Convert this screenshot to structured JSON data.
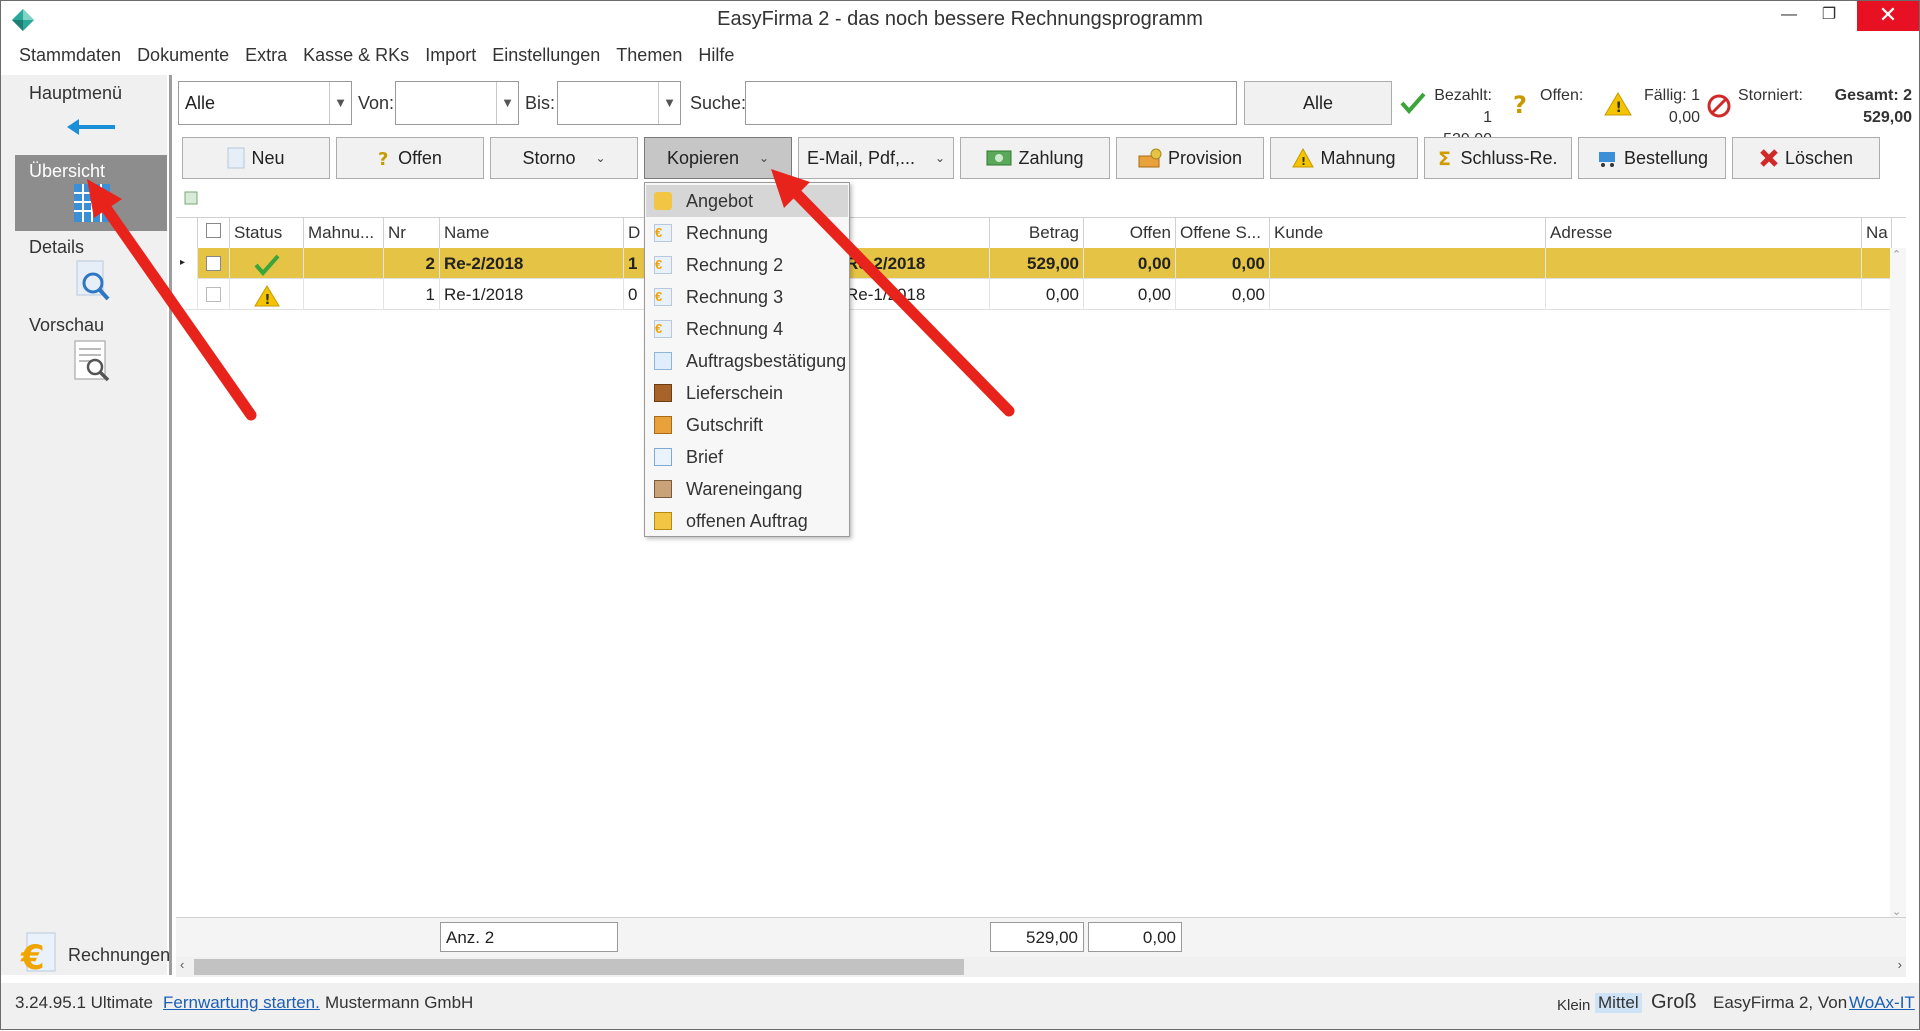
{
  "window": {
    "title": "EasyFirma 2 - das noch bessere Rechnungsprogramm",
    "minimize_glyph": "—",
    "maximize_glyph": "❐",
    "close_glyph": "✕"
  },
  "menu": [
    "Stammdaten",
    "Dokumente",
    "Extra",
    "Kasse & RKs",
    "Import",
    "Einstellungen",
    "Themen",
    "Hilfe"
  ],
  "sidebar": {
    "main_menu": "Hauptmenü",
    "items": [
      "Übersicht",
      "Details",
      "Vorschau"
    ],
    "active": "Übersicht",
    "module_label": "Rechnungen"
  },
  "filters": {
    "type_value": "Alle",
    "from_label": "Von:",
    "from_value": "",
    "to_label": "Bis:",
    "to_value": "",
    "search_label": "Suche:",
    "search_value": "",
    "all_button": "Alle"
  },
  "stats": {
    "paid_label": "Bezahlt: 1",
    "paid_value": "529,00",
    "open_label": "Offen:",
    "due_label": "Fällig: 1",
    "due_value": "0,00",
    "cancelled_label": "Storniert:",
    "total_label": "Gesamt: 2",
    "total_value": "529,00"
  },
  "toolbar": {
    "new": "Neu",
    "open": "Offen",
    "storno": "Storno",
    "copy": "Kopieren",
    "email": "E-Mail, Pdf,...",
    "payment": "Zahlung",
    "commission": "Provision",
    "reminder": "Mahnung",
    "final": "Schluss-Re.",
    "order": "Bestellung",
    "delete": "Löschen"
  },
  "table": {
    "columns": [
      "",
      "Status",
      "Mahnu...",
      "Nr",
      "Name",
      "D",
      "",
      "Betrag",
      "Offen",
      "Offene S...",
      "Kunde",
      "Adresse",
      "Na"
    ],
    "rows": [
      {
        "status": "paid",
        "nr": "2",
        "name": "Re-2/2018",
        "d": "1",
        "ref": "Re-2/2018",
        "betrag": "529,00",
        "offen": "0,00",
        "offene_s": "0,00",
        "selected": true
      },
      {
        "status": "due",
        "nr": "1",
        "name": "Re-1/2018",
        "d": "0",
        "ref": "Re-1/2018",
        "betrag": "0,00",
        "offen": "0,00",
        "offene_s": "0,00",
        "selected": false
      }
    ],
    "footer": {
      "count": "Anz. 2",
      "sum_betrag": "529,00",
      "sum_offen": "0,00"
    }
  },
  "copy_menu": {
    "items": [
      "Angebot",
      "Rechnung",
      "Rechnung 2",
      "Rechnung 3",
      "Rechnung 4",
      "Auftragsbestätigung",
      "Lieferschein",
      "Gutschrift",
      "Brief",
      "Wareneingang",
      "offenen Auftrag"
    ],
    "highlighted": "Angebot"
  },
  "statusbar": {
    "version": "3.24.95.1 Ultimate",
    "remote": "Fernwartung starten.",
    "company": "Mustermann GmbH",
    "size_small": "Klein",
    "size_medium": "Mittel",
    "size_large": "Groß",
    "credit": "EasyFirma 2, Von",
    "credit_link": "WoAx-IT"
  },
  "colors": {
    "selection_row": "#e5c345",
    "annotation_arrow": "#e8231c",
    "accent_blue": "#1b5fb6"
  }
}
